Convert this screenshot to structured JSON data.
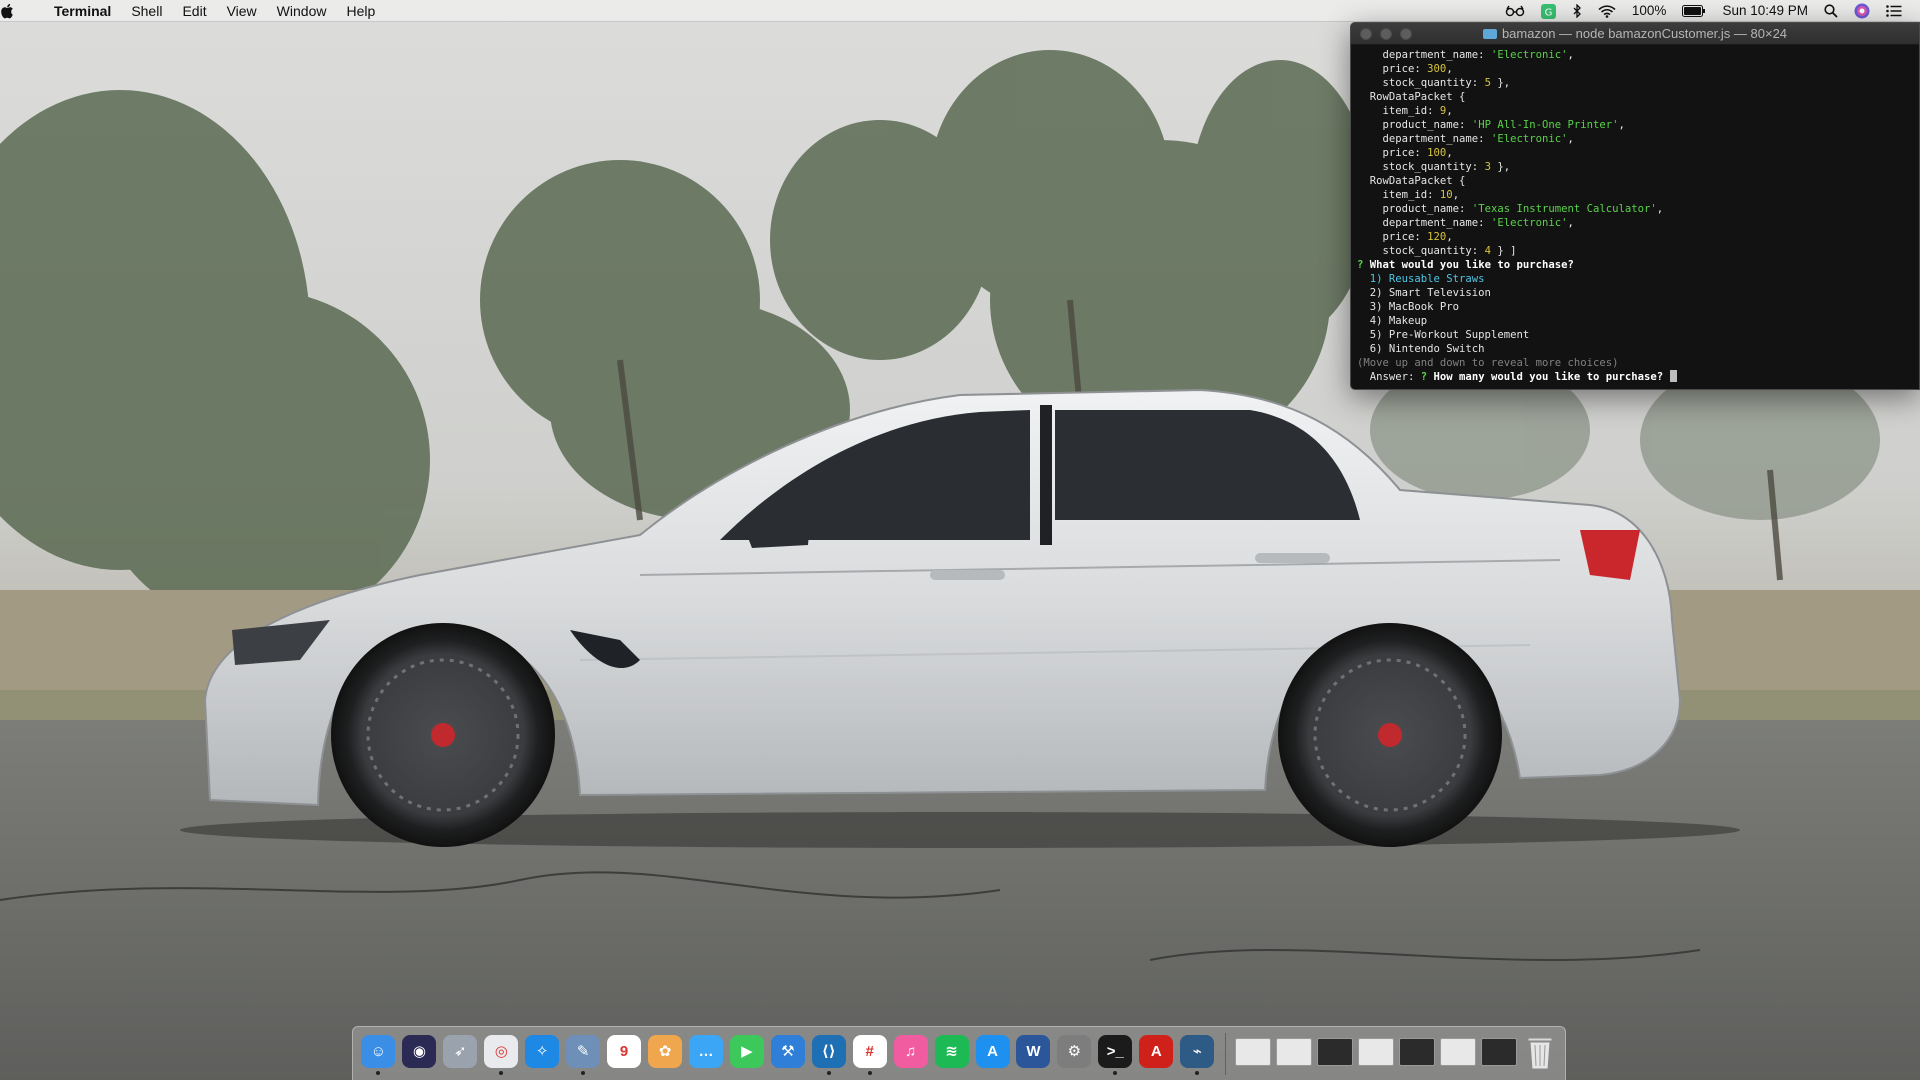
{
  "menubar": {
    "apple_icon": "apple-logo",
    "app_name": "Terminal",
    "menus": [
      "Shell",
      "Edit",
      "View",
      "Window",
      "Help"
    ],
    "status": {
      "battery": "100%",
      "clock": "Sun 10:49 PM"
    }
  },
  "terminal": {
    "title": "bamazon — node bamazonCustomer.js — 80×24",
    "lines": [
      {
        "parts": [
          {
            "c": "",
            "t": "    department_name: "
          },
          {
            "c": "str",
            "t": "'Electronic'"
          },
          {
            "c": "",
            "t": ","
          }
        ]
      },
      {
        "parts": [
          {
            "c": "",
            "t": "    price: "
          },
          {
            "c": "num",
            "t": "300"
          },
          {
            "c": "",
            "t": ","
          }
        ]
      },
      {
        "parts": [
          {
            "c": "",
            "t": "    stock_quantity: "
          },
          {
            "c": "num",
            "t": "5"
          },
          {
            "c": "",
            "t": " },"
          }
        ]
      },
      {
        "parts": [
          {
            "c": "",
            "t": "  RowDataPacket {"
          }
        ]
      },
      {
        "parts": [
          {
            "c": "",
            "t": "    item_id: "
          },
          {
            "c": "num",
            "t": "9"
          },
          {
            "c": "",
            "t": ","
          }
        ]
      },
      {
        "parts": [
          {
            "c": "",
            "t": "    product_name: "
          },
          {
            "c": "str",
            "t": "'HP All-In-One Printer'"
          },
          {
            "c": "",
            "t": ","
          }
        ]
      },
      {
        "parts": [
          {
            "c": "",
            "t": "    department_name: "
          },
          {
            "c": "str",
            "t": "'Electronic'"
          },
          {
            "c": "",
            "t": ","
          }
        ]
      },
      {
        "parts": [
          {
            "c": "",
            "t": "    price: "
          },
          {
            "c": "num",
            "t": "100"
          },
          {
            "c": "",
            "t": ","
          }
        ]
      },
      {
        "parts": [
          {
            "c": "",
            "t": "    stock_quantity: "
          },
          {
            "c": "num",
            "t": "3"
          },
          {
            "c": "",
            "t": " },"
          }
        ]
      },
      {
        "parts": [
          {
            "c": "",
            "t": "  RowDataPacket {"
          }
        ]
      },
      {
        "parts": [
          {
            "c": "",
            "t": "    item_id: "
          },
          {
            "c": "num",
            "t": "10"
          },
          {
            "c": "",
            "t": ","
          }
        ]
      },
      {
        "parts": [
          {
            "c": "",
            "t": "    product_name: "
          },
          {
            "c": "str",
            "t": "'Texas Instrument Calculator'"
          },
          {
            "c": "",
            "t": ","
          }
        ]
      },
      {
        "parts": [
          {
            "c": "",
            "t": "    department_name: "
          },
          {
            "c": "str",
            "t": "'Electronic'"
          },
          {
            "c": "",
            "t": ","
          }
        ]
      },
      {
        "parts": [
          {
            "c": "",
            "t": "    price: "
          },
          {
            "c": "num",
            "t": "120"
          },
          {
            "c": "",
            "t": ","
          }
        ]
      },
      {
        "parts": [
          {
            "c": "",
            "t": "    stock_quantity: "
          },
          {
            "c": "num",
            "t": "4"
          },
          {
            "c": "",
            "t": " } ]"
          }
        ]
      },
      {
        "parts": [
          {
            "c": "q",
            "t": "? "
          },
          {
            "c": "bold",
            "t": "What would you like to purchase?"
          }
        ]
      },
      {
        "parts": [
          {
            "c": "cyan",
            "t": "  1) Reusable Straws"
          }
        ]
      },
      {
        "parts": [
          {
            "c": "",
            "t": "  2) Smart Television"
          }
        ]
      },
      {
        "parts": [
          {
            "c": "",
            "t": "  3) MacBook Pro"
          }
        ]
      },
      {
        "parts": [
          {
            "c": "",
            "t": "  4) Makeup"
          }
        ]
      },
      {
        "parts": [
          {
            "c": "",
            "t": "  5) Pre-Workout Supplement"
          }
        ]
      },
      {
        "parts": [
          {
            "c": "",
            "t": "  6) Nintendo Switch"
          }
        ]
      },
      {
        "parts": [
          {
            "c": "dim",
            "t": "(Move up and down to reveal more choices)"
          }
        ]
      },
      {
        "parts": [
          {
            "c": "",
            "t": "  Answer: "
          },
          {
            "c": "q",
            "t": "? "
          },
          {
            "c": "bold",
            "t": "How many would you like to purchase? "
          }
        ],
        "cursor": true
      }
    ]
  },
  "dock": {
    "apps": [
      {
        "name": "finder-icon",
        "color": "#3a8ee6",
        "glyph": "☺",
        "running": true
      },
      {
        "name": "siri-icon",
        "color": "#2a2a55",
        "glyph": "◉",
        "running": false
      },
      {
        "name": "launchpad-icon",
        "color": "#9aa3ad",
        "glyph": "➶",
        "running": false
      },
      {
        "name": "chrome-icon",
        "color": "#e8eaed",
        "glyph": "◎",
        "running": true
      },
      {
        "name": "safari-icon",
        "color": "#1e88e5",
        "glyph": "✧",
        "running": false
      },
      {
        "name": "preview-icon",
        "color": "#6d8fb8",
        "glyph": "✎",
        "running": true
      },
      {
        "name": "calendar-icon",
        "color": "#ffffff",
        "glyph": "9",
        "running": false
      },
      {
        "name": "photos-icon",
        "color": "#f0a64d",
        "glyph": "✿",
        "running": false
      },
      {
        "name": "messages-icon",
        "color": "#3ba6f5",
        "glyph": "…",
        "running": false
      },
      {
        "name": "facetime-icon",
        "color": "#3cc85a",
        "glyph": "▶",
        "running": false
      },
      {
        "name": "xcode-icon",
        "color": "#2f7ed8",
        "glyph": "⚒",
        "running": false
      },
      {
        "name": "vscode-icon",
        "color": "#1f6fb5",
        "glyph": "⟨⟩",
        "running": true
      },
      {
        "name": "slack-icon",
        "color": "#ffffff",
        "glyph": "#",
        "running": true
      },
      {
        "name": "itunes-icon",
        "color": "#f15ca0",
        "glyph": "♫",
        "running": false
      },
      {
        "name": "spotify-icon",
        "color": "#1db954",
        "glyph": "≋",
        "running": false
      },
      {
        "name": "app-store-icon",
        "color": "#1e90f0",
        "glyph": "A",
        "running": false
      },
      {
        "name": "word-icon",
        "color": "#2b579a",
        "glyph": "W",
        "running": false
      },
      {
        "name": "system-preferences-icon",
        "color": "#7d7d7d",
        "glyph": "⚙",
        "running": false
      },
      {
        "name": "terminal-icon",
        "color": "#1b1b1b",
        "glyph": ">_",
        "running": true
      },
      {
        "name": "acrobat-icon",
        "color": "#d0201a",
        "glyph": "A",
        "running": false
      },
      {
        "name": "mysql-workbench-icon",
        "color": "#2d5b85",
        "glyph": "⌁",
        "running": true
      }
    ],
    "windows": [
      {
        "name": "minimized-window-1",
        "dark": false
      },
      {
        "name": "minimized-window-2",
        "dark": false
      },
      {
        "name": "minimized-window-3",
        "dark": true
      },
      {
        "name": "minimized-window-4",
        "dark": false
      },
      {
        "name": "minimized-window-5",
        "dark": true
      },
      {
        "name": "minimized-window-6",
        "dark": false
      },
      {
        "name": "minimized-window-7",
        "dark": true
      }
    ],
    "trash": {
      "name": "trash-icon"
    }
  }
}
